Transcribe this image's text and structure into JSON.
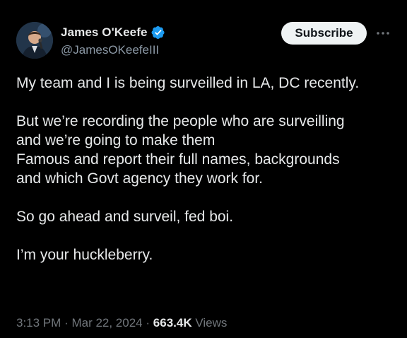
{
  "author": {
    "display_name": "James O'Keefe",
    "handle": "@JamesOKeefeIII",
    "verified_icon": "verified-badge-icon"
  },
  "actions": {
    "subscribe_label": "Subscribe",
    "more_icon": "more-options-icon"
  },
  "tweet": {
    "paragraphs": [
      [
        "My team and I is being surveilled in LA, DC recently."
      ],
      [
        "But we’re recording the people who are surveilling",
        "and we’re going to make them",
        "Famous and report their full names, backgrounds",
        "and which Govt agency they work for."
      ],
      [
        "So go ahead and surveil, fed boi."
      ],
      [
        "I’m your huckleberry."
      ]
    ]
  },
  "meta": {
    "time": "3:13 PM",
    "separator": "·",
    "date": "Mar 22, 2024",
    "views_count": "663.4K",
    "views_label": "Views"
  },
  "colors": {
    "background": "#000000",
    "text": "#e7e9ea",
    "secondary_text": "#71767b",
    "verified_blue": "#1d9bf0",
    "subscribe_bg": "#eff3f4"
  }
}
